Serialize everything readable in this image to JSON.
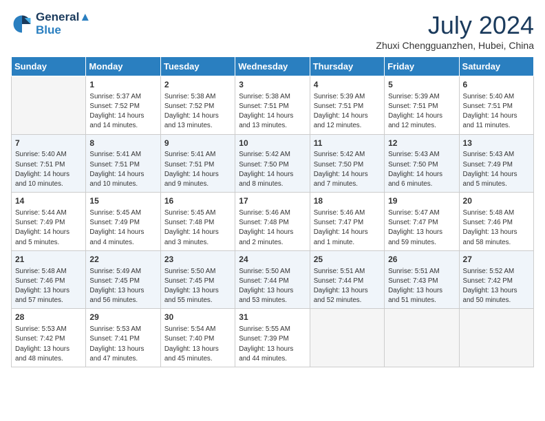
{
  "header": {
    "logo_line1": "General",
    "logo_line2": "Blue",
    "month_title": "July 2024",
    "location": "Zhuxi Chengguanzhen, Hubei, China"
  },
  "days_of_week": [
    "Sunday",
    "Monday",
    "Tuesday",
    "Wednesday",
    "Thursday",
    "Friday",
    "Saturday"
  ],
  "weeks": [
    [
      {
        "num": "",
        "info": ""
      },
      {
        "num": "1",
        "info": "Sunrise: 5:37 AM\nSunset: 7:52 PM\nDaylight: 14 hours\nand 14 minutes."
      },
      {
        "num": "2",
        "info": "Sunrise: 5:38 AM\nSunset: 7:52 PM\nDaylight: 14 hours\nand 13 minutes."
      },
      {
        "num": "3",
        "info": "Sunrise: 5:38 AM\nSunset: 7:51 PM\nDaylight: 14 hours\nand 13 minutes."
      },
      {
        "num": "4",
        "info": "Sunrise: 5:39 AM\nSunset: 7:51 PM\nDaylight: 14 hours\nand 12 minutes."
      },
      {
        "num": "5",
        "info": "Sunrise: 5:39 AM\nSunset: 7:51 PM\nDaylight: 14 hours\nand 12 minutes."
      },
      {
        "num": "6",
        "info": "Sunrise: 5:40 AM\nSunset: 7:51 PM\nDaylight: 14 hours\nand 11 minutes."
      }
    ],
    [
      {
        "num": "7",
        "info": "Sunrise: 5:40 AM\nSunset: 7:51 PM\nDaylight: 14 hours\nand 10 minutes."
      },
      {
        "num": "8",
        "info": "Sunrise: 5:41 AM\nSunset: 7:51 PM\nDaylight: 14 hours\nand 10 minutes."
      },
      {
        "num": "9",
        "info": "Sunrise: 5:41 AM\nSunset: 7:51 PM\nDaylight: 14 hours\nand 9 minutes."
      },
      {
        "num": "10",
        "info": "Sunrise: 5:42 AM\nSunset: 7:50 PM\nDaylight: 14 hours\nand 8 minutes."
      },
      {
        "num": "11",
        "info": "Sunrise: 5:42 AM\nSunset: 7:50 PM\nDaylight: 14 hours\nand 7 minutes."
      },
      {
        "num": "12",
        "info": "Sunrise: 5:43 AM\nSunset: 7:50 PM\nDaylight: 14 hours\nand 6 minutes."
      },
      {
        "num": "13",
        "info": "Sunrise: 5:43 AM\nSunset: 7:49 PM\nDaylight: 14 hours\nand 5 minutes."
      }
    ],
    [
      {
        "num": "14",
        "info": "Sunrise: 5:44 AM\nSunset: 7:49 PM\nDaylight: 14 hours\nand 5 minutes."
      },
      {
        "num": "15",
        "info": "Sunrise: 5:45 AM\nSunset: 7:49 PM\nDaylight: 14 hours\nand 4 minutes."
      },
      {
        "num": "16",
        "info": "Sunrise: 5:45 AM\nSunset: 7:48 PM\nDaylight: 14 hours\nand 3 minutes."
      },
      {
        "num": "17",
        "info": "Sunrise: 5:46 AM\nSunset: 7:48 PM\nDaylight: 14 hours\nand 2 minutes."
      },
      {
        "num": "18",
        "info": "Sunrise: 5:46 AM\nSunset: 7:47 PM\nDaylight: 14 hours\nand 1 minute."
      },
      {
        "num": "19",
        "info": "Sunrise: 5:47 AM\nSunset: 7:47 PM\nDaylight: 13 hours\nand 59 minutes."
      },
      {
        "num": "20",
        "info": "Sunrise: 5:48 AM\nSunset: 7:46 PM\nDaylight: 13 hours\nand 58 minutes."
      }
    ],
    [
      {
        "num": "21",
        "info": "Sunrise: 5:48 AM\nSunset: 7:46 PM\nDaylight: 13 hours\nand 57 minutes."
      },
      {
        "num": "22",
        "info": "Sunrise: 5:49 AM\nSunset: 7:45 PM\nDaylight: 13 hours\nand 56 minutes."
      },
      {
        "num": "23",
        "info": "Sunrise: 5:50 AM\nSunset: 7:45 PM\nDaylight: 13 hours\nand 55 minutes."
      },
      {
        "num": "24",
        "info": "Sunrise: 5:50 AM\nSunset: 7:44 PM\nDaylight: 13 hours\nand 53 minutes."
      },
      {
        "num": "25",
        "info": "Sunrise: 5:51 AM\nSunset: 7:44 PM\nDaylight: 13 hours\nand 52 minutes."
      },
      {
        "num": "26",
        "info": "Sunrise: 5:51 AM\nSunset: 7:43 PM\nDaylight: 13 hours\nand 51 minutes."
      },
      {
        "num": "27",
        "info": "Sunrise: 5:52 AM\nSunset: 7:42 PM\nDaylight: 13 hours\nand 50 minutes."
      }
    ],
    [
      {
        "num": "28",
        "info": "Sunrise: 5:53 AM\nSunset: 7:42 PM\nDaylight: 13 hours\nand 48 minutes."
      },
      {
        "num": "29",
        "info": "Sunrise: 5:53 AM\nSunset: 7:41 PM\nDaylight: 13 hours\nand 47 minutes."
      },
      {
        "num": "30",
        "info": "Sunrise: 5:54 AM\nSunset: 7:40 PM\nDaylight: 13 hours\nand 45 minutes."
      },
      {
        "num": "31",
        "info": "Sunrise: 5:55 AM\nSunset: 7:39 PM\nDaylight: 13 hours\nand 44 minutes."
      },
      {
        "num": "",
        "info": ""
      },
      {
        "num": "",
        "info": ""
      },
      {
        "num": "",
        "info": ""
      }
    ]
  ]
}
